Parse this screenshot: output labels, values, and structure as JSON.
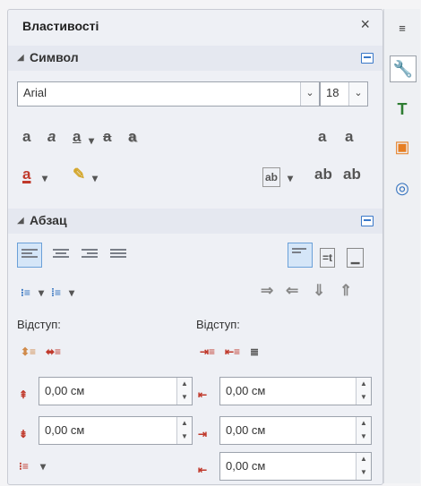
{
  "panel": {
    "title": "Властивості",
    "close_glyph": "×"
  },
  "symbol": {
    "header": "Символ",
    "font_name": "Arial",
    "font_size": "18",
    "glyphs": {
      "bold": "a",
      "italic": "a",
      "underline": "a",
      "strike": "a",
      "shadow": "a",
      "grow": "a",
      "shrink": "a",
      "font_color": "a",
      "highlight": "✎",
      "spacing": "ab",
      "superscript": "ab",
      "subscript": "ab"
    }
  },
  "paragraph": {
    "header": "Абзац",
    "indent_label_left": "Відступ:",
    "indent_label_right": "Відступ:",
    "before_indent": "0,00 см",
    "after_indent": "0,00 см",
    "spacing_above": "0,00 см",
    "spacing_below": "0,00 см",
    "first_line": "0,00 см",
    "arrows": [
      "⇒",
      "⇐",
      "⇓",
      "⇑"
    ]
  },
  "colors": {
    "accent": "#3a78c8",
    "font_color": "#c0392b",
    "highlight": "#f2c94c"
  },
  "sidebar_icons": [
    "menu-icon",
    "wrench-icon",
    "styles-icon",
    "gallery-icon",
    "navigator-icon"
  ]
}
